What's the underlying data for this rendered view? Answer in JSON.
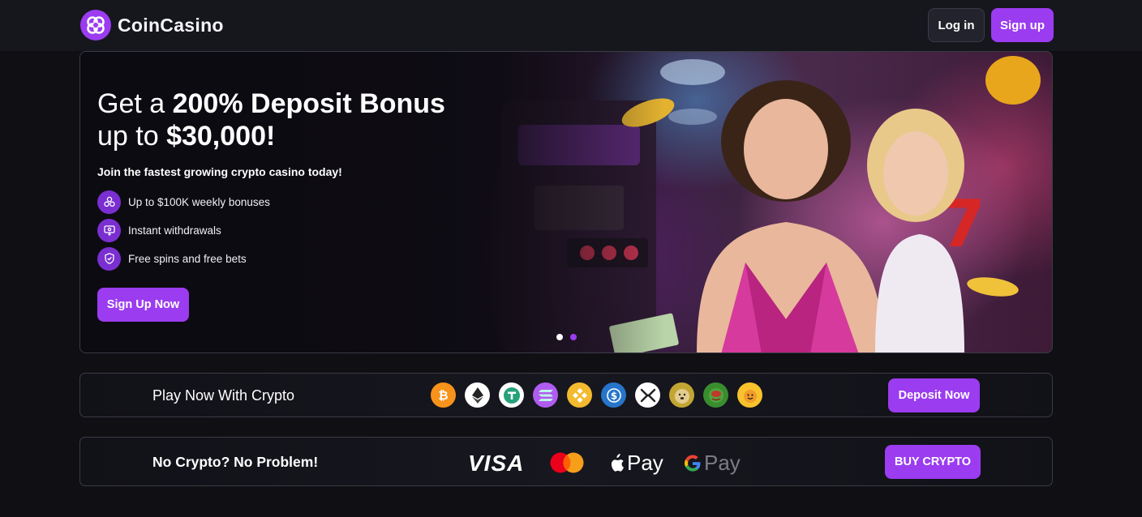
{
  "header": {
    "brand": "CoinCasino",
    "login_label": "Log in",
    "signup_label": "Sign up"
  },
  "hero": {
    "title_part1": "Get a ",
    "title_bold1": "200% Deposit Bonus",
    "title_part2": "up to ",
    "title_bold2": "$30,000!",
    "subtitle": "Join the fastest growing crypto casino today!",
    "features": [
      {
        "label": "Up to $100K weekly bonuses",
        "icon": "coin-stack-icon"
      },
      {
        "label": "Instant withdrawals",
        "icon": "withdraw-icon"
      },
      {
        "label": "Free spins and free bets",
        "icon": "shield-check-icon"
      }
    ],
    "cta_label": "Sign Up Now",
    "slides": {
      "count": 2,
      "active": 1
    }
  },
  "crypto_strip": {
    "label": "Play Now With Crypto",
    "coins": [
      {
        "name": "bitcoin-icon",
        "glyph": "₿",
        "color": "#f7931a"
      },
      {
        "name": "ethereum-icon",
        "glyph": "◆",
        "color": "#ffffff"
      },
      {
        "name": "tether-icon",
        "glyph": "T",
        "color": "#ffffff"
      },
      {
        "name": "solana-icon",
        "glyph": "≡",
        "color": "#b05cf0"
      },
      {
        "name": "binance-icon",
        "glyph": "◈",
        "color": "#f3ba2f"
      },
      {
        "name": "usdc-icon",
        "glyph": "$",
        "color": "#2775ca"
      },
      {
        "name": "xrp-icon",
        "glyph": "✕",
        "color": "#ffffff"
      },
      {
        "name": "dogecoin-icon",
        "glyph": "Ð",
        "color": "#c2a633"
      },
      {
        "name": "pepe-icon",
        "glyph": "☻",
        "color": "#3a8d2e"
      },
      {
        "name": "bonk-icon",
        "glyph": "☺",
        "color": "#f8c22c"
      }
    ],
    "button_label": "Deposit Now"
  },
  "fiat_strip": {
    "label": "No Crypto? No Problem!",
    "visa": "VISA",
    "apple_pay": "Pay",
    "google_pay": "Pay",
    "button_label": "BUY CRYPTO"
  },
  "colors": {
    "accent": "#9b3cf0",
    "background": "#0f0f14",
    "border": "#3b3b45"
  }
}
